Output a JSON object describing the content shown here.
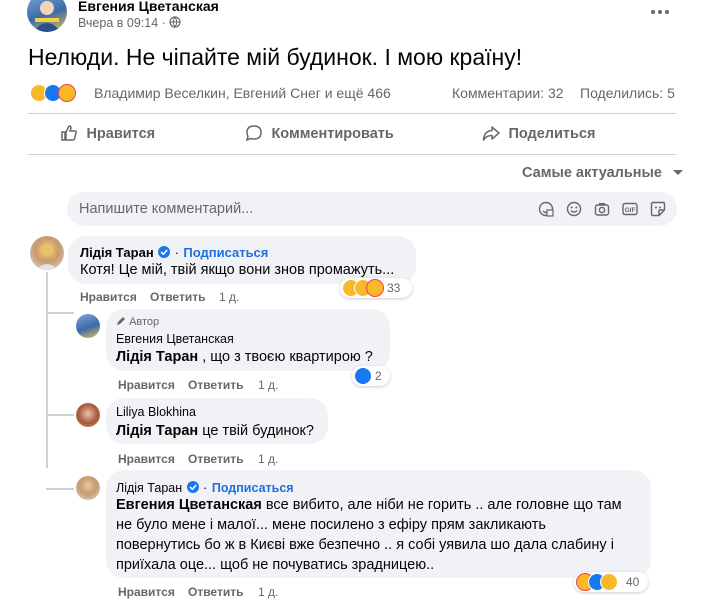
{
  "post": {
    "author": "Евгения Цветанская",
    "time": "Вчера в 09:14",
    "privacy_sep": "·",
    "more_icon": "more-horizontal-icon",
    "text": "Нелюди. Не чіпайте мій будинок. І мою країну!",
    "reactions_names": "Владимир Веселкин, Евгений Снег и ещё 466",
    "comments_count": "Комментарии: 32",
    "shares_count": "Поделились: 5"
  },
  "actions": {
    "like": "Нравится",
    "comment": "Комментировать",
    "share": "Поделиться"
  },
  "sort": {
    "label": "Самые актуальные"
  },
  "composer": {
    "placeholder": "Напишите комментарий..."
  },
  "comments": [
    {
      "author": "Лідія Таран",
      "follow": "Подписаться",
      "text": "Котя! Це мій, твій якщо вони знов промажуть...",
      "like": "Нравится",
      "reply": "Ответить",
      "time": "1 д.",
      "reactions_count": "33"
    },
    {
      "badge": "Автор",
      "author": "Евгения Цветанская",
      "mention": "Лідія Таран",
      "text": " , що з твоєю квартирою ?",
      "like": "Нравится",
      "reply": "Ответить",
      "time": "1 д.",
      "reactions_count": "2"
    },
    {
      "author": "Liliya Blokhina",
      "mention": "Лідія Таран",
      "text": " це твій будинок?",
      "like": "Нравится",
      "reply": "Ответить",
      "time": "1 д."
    },
    {
      "author": "Лідія Таран",
      "follow": "Подписаться",
      "mention": "Евгения Цветанская",
      "text_line1": " все вибито, але ніби не горить .. але головне що там",
      "text_line2": "не було мене і малої... мене посилено з ефіру прям закликають",
      "text_line3": "повернутись бо ж в Києві вже безпечно .. я собі уявила шо дала слабину і",
      "text_line4": "приїхала оце... щоб не почуватись зрадницею..",
      "like": "Нравится",
      "reply": "Ответить",
      "time": "1 д.",
      "reactions_count": "40"
    }
  ],
  "colors": {
    "like_blue": "#1877f2",
    "sad_yellow": "#f7b928",
    "love_red": "#f33e58",
    "bubble_gray": "#f0f2f5",
    "link_blue": "#216fdb"
  }
}
